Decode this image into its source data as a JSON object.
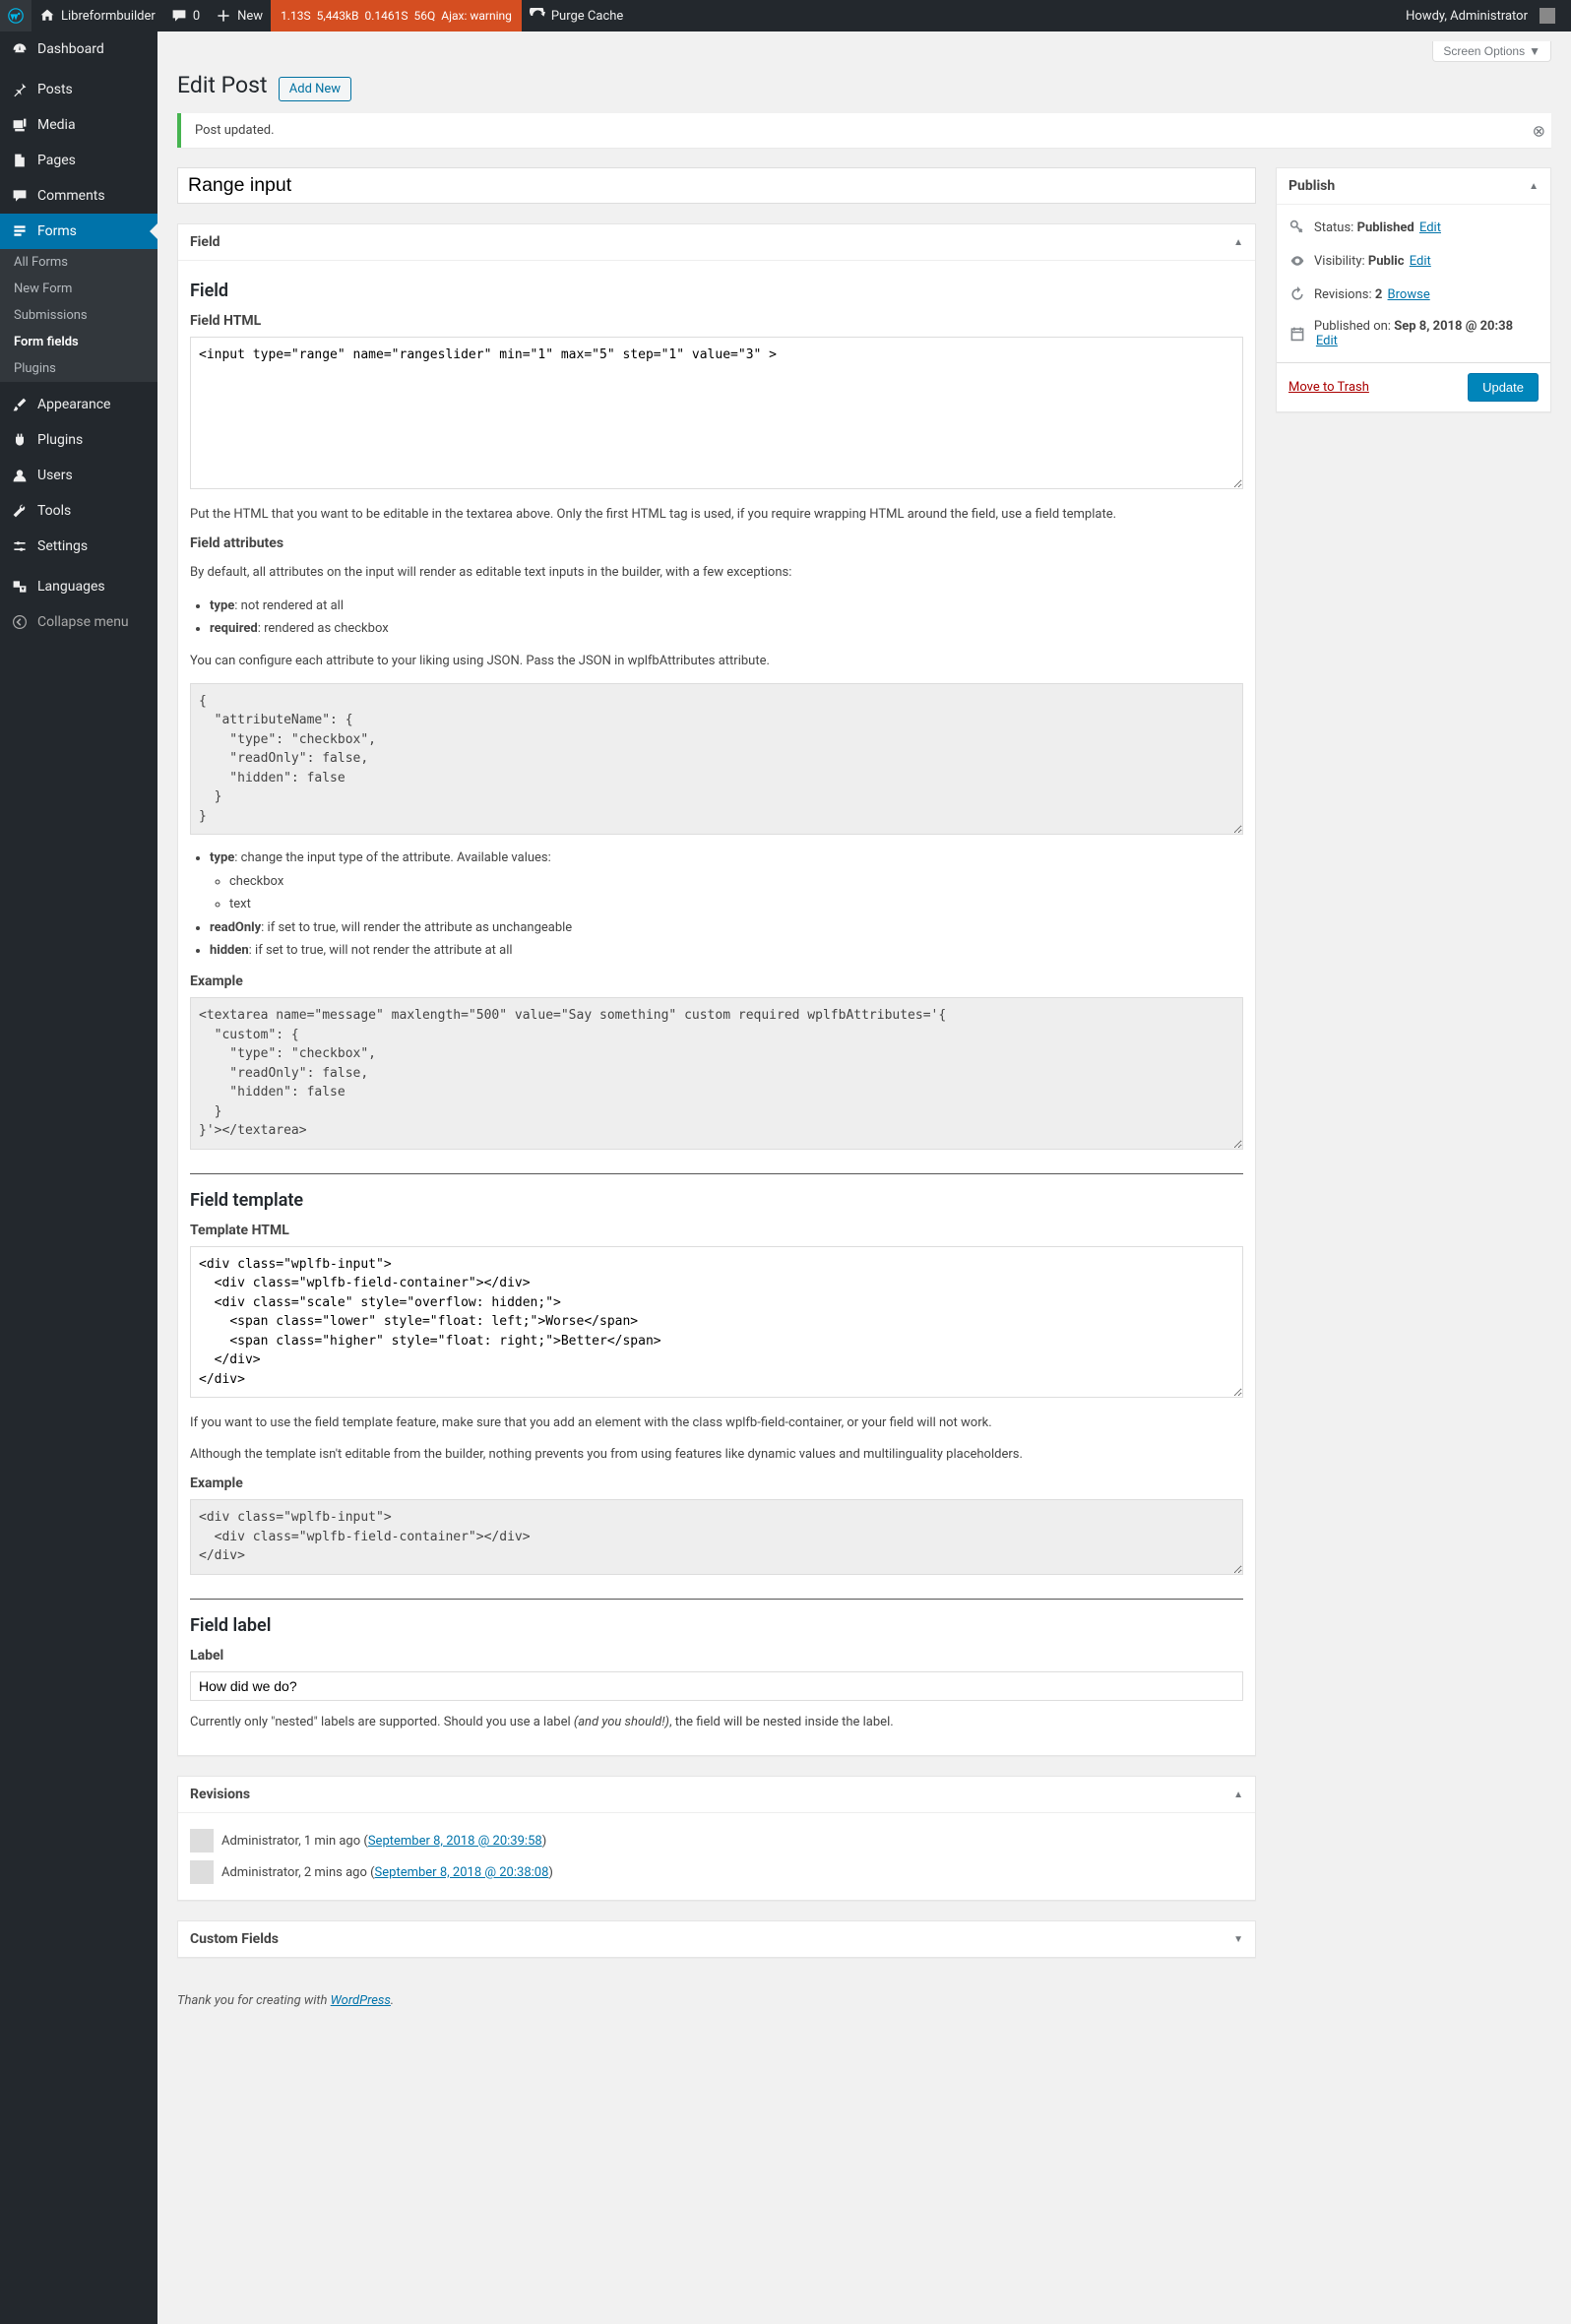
{
  "adminbar": {
    "site_name": "Libreformbuilder",
    "comments_count": "0",
    "new_label": "New",
    "qm": {
      "time": "1.13S",
      "mem": "5,443kB",
      "dbtime": "0.1461S",
      "queries": "56Q",
      "ajax": "Ajax: warning"
    },
    "purge": "Purge Cache",
    "howdy": "Howdy, Administrator"
  },
  "menu": {
    "dashboard": "Dashboard",
    "posts": "Posts",
    "media": "Media",
    "pages": "Pages",
    "comments": "Comments",
    "forms": "Forms",
    "forms_sub": {
      "all": "All Forms",
      "new": "New Form",
      "submissions": "Submissions",
      "fields": "Form fields",
      "plugins": "Plugins"
    },
    "appearance": "Appearance",
    "plugins": "Plugins",
    "users": "Users",
    "tools": "Tools",
    "settings": "Settings",
    "languages": "Languages",
    "collapse": "Collapse menu"
  },
  "screen_options": "Screen Options",
  "page": {
    "heading": "Edit Post",
    "add_new": "Add New"
  },
  "notice": {
    "text": "Post updated."
  },
  "title_value": "Range input",
  "fieldbox": {
    "title": "Field",
    "section_field": "Field",
    "label_html": "Field HTML",
    "html_value": "<input type=\"range\" name=\"rangeslider\" min=\"1\" max=\"5\" step=\"1\" value=\"3\" >",
    "desc_html": "Put the HTML that you want to be editable in the textarea above. Only the first HTML tag is used, if you require wrapping HTML around the field, use a field template.",
    "attr_heading": "Field attributes",
    "attr_desc": "By default, all attributes on the input will render as editable text inputs in the builder, with a few exceptions:",
    "attr_li1_strong": "type",
    "attr_li1_rest": ": not rendered at all",
    "attr_li2_strong": "required",
    "attr_li2_rest": ": rendered as checkbox",
    "attr_json_desc": "You can configure each attribute to your liking using JSON. Pass the JSON in wplfbAttributes attribute.",
    "attr_json_code": "{\n  \"attributeName\": {\n    \"type\": \"checkbox\",\n    \"readOnly\": false,\n    \"hidden\": false\n  }\n}",
    "attr2_li1_strong": "type",
    "attr2_li1_rest": ": change the input type of the attribute. Available values:",
    "attr2_li1_sub1": "checkbox",
    "attr2_li1_sub2": "text",
    "attr2_li2_strong": "readOnly",
    "attr2_li2_rest": ": if set to true, will render the attribute as unchangeable",
    "attr2_li3_strong": "hidden",
    "attr2_li3_rest": ": if set to true, will not render the attribute at all",
    "example_heading": "Example",
    "example_code": "<textarea name=\"message\" maxlength=\"500\" value=\"Say something\" custom required wplfbAttributes='{\n  \"custom\": {\n    \"type\": \"checkbox\",\n    \"readOnly\": false,\n    \"hidden\": false\n  }\n}'></textarea>",
    "template_heading": "Field template",
    "template_label": "Template HTML",
    "template_value": "<div class=\"wplfb-input\">\n  <div class=\"wplfb-field-container\"></div>\n  <div class=\"scale\" style=\"overflow: hidden;\">\n    <span class=\"lower\" style=\"float: left;\">Worse</span>\n    <span class=\"higher\" style=\"float: right;\">Better</span>\n  </div>\n</div>",
    "template_desc1": "If you want to use the field template feature, make sure that you add an element with the class wplfb-field-container, or your field will not work.",
    "template_desc2": "Although the template isn't editable from the builder, nothing prevents you from using features like dynamic values and multilinguality placeholders.",
    "template_example_code": "<div class=\"wplfb-input\">\n  <div class=\"wplfb-field-container\"></div>\n</div>",
    "label_heading": "Field label",
    "label_label": "Label",
    "label_value": "How did we do?",
    "label_desc_pre": "Currently only \"nested\" labels are supported. Should you use a label ",
    "label_desc_em": "(and you should!)",
    "label_desc_post": ", the field will be nested inside the label."
  },
  "publish": {
    "title": "Publish",
    "status_label": "Status:",
    "status_value": "Published",
    "status_edit": "Edit",
    "visibility_label": "Visibility:",
    "visibility_value": "Public",
    "visibility_edit": "Edit",
    "revisions_label": "Revisions:",
    "revisions_count": "2",
    "revisions_browse": "Browse",
    "published_label": "Published on:",
    "published_value": "Sep 8, 2018 @ 20:38",
    "published_edit": "Edit",
    "trash": "Move to Trash",
    "update": "Update"
  },
  "revisions": {
    "title": "Revisions",
    "items": [
      {
        "author": "Administrator",
        "ago": ", 1 min ago (",
        "link": "September 8, 2018 @ 20:39:58",
        "close": ")"
      },
      {
        "author": "Administrator",
        "ago": ", 2 mins ago (",
        "link": "September 8, 2018 @ 20:38:08",
        "close": ")"
      }
    ]
  },
  "customfields": {
    "title": "Custom Fields"
  },
  "footer": {
    "pre": "Thank you for creating with ",
    "link": "WordPress",
    "post": "."
  }
}
